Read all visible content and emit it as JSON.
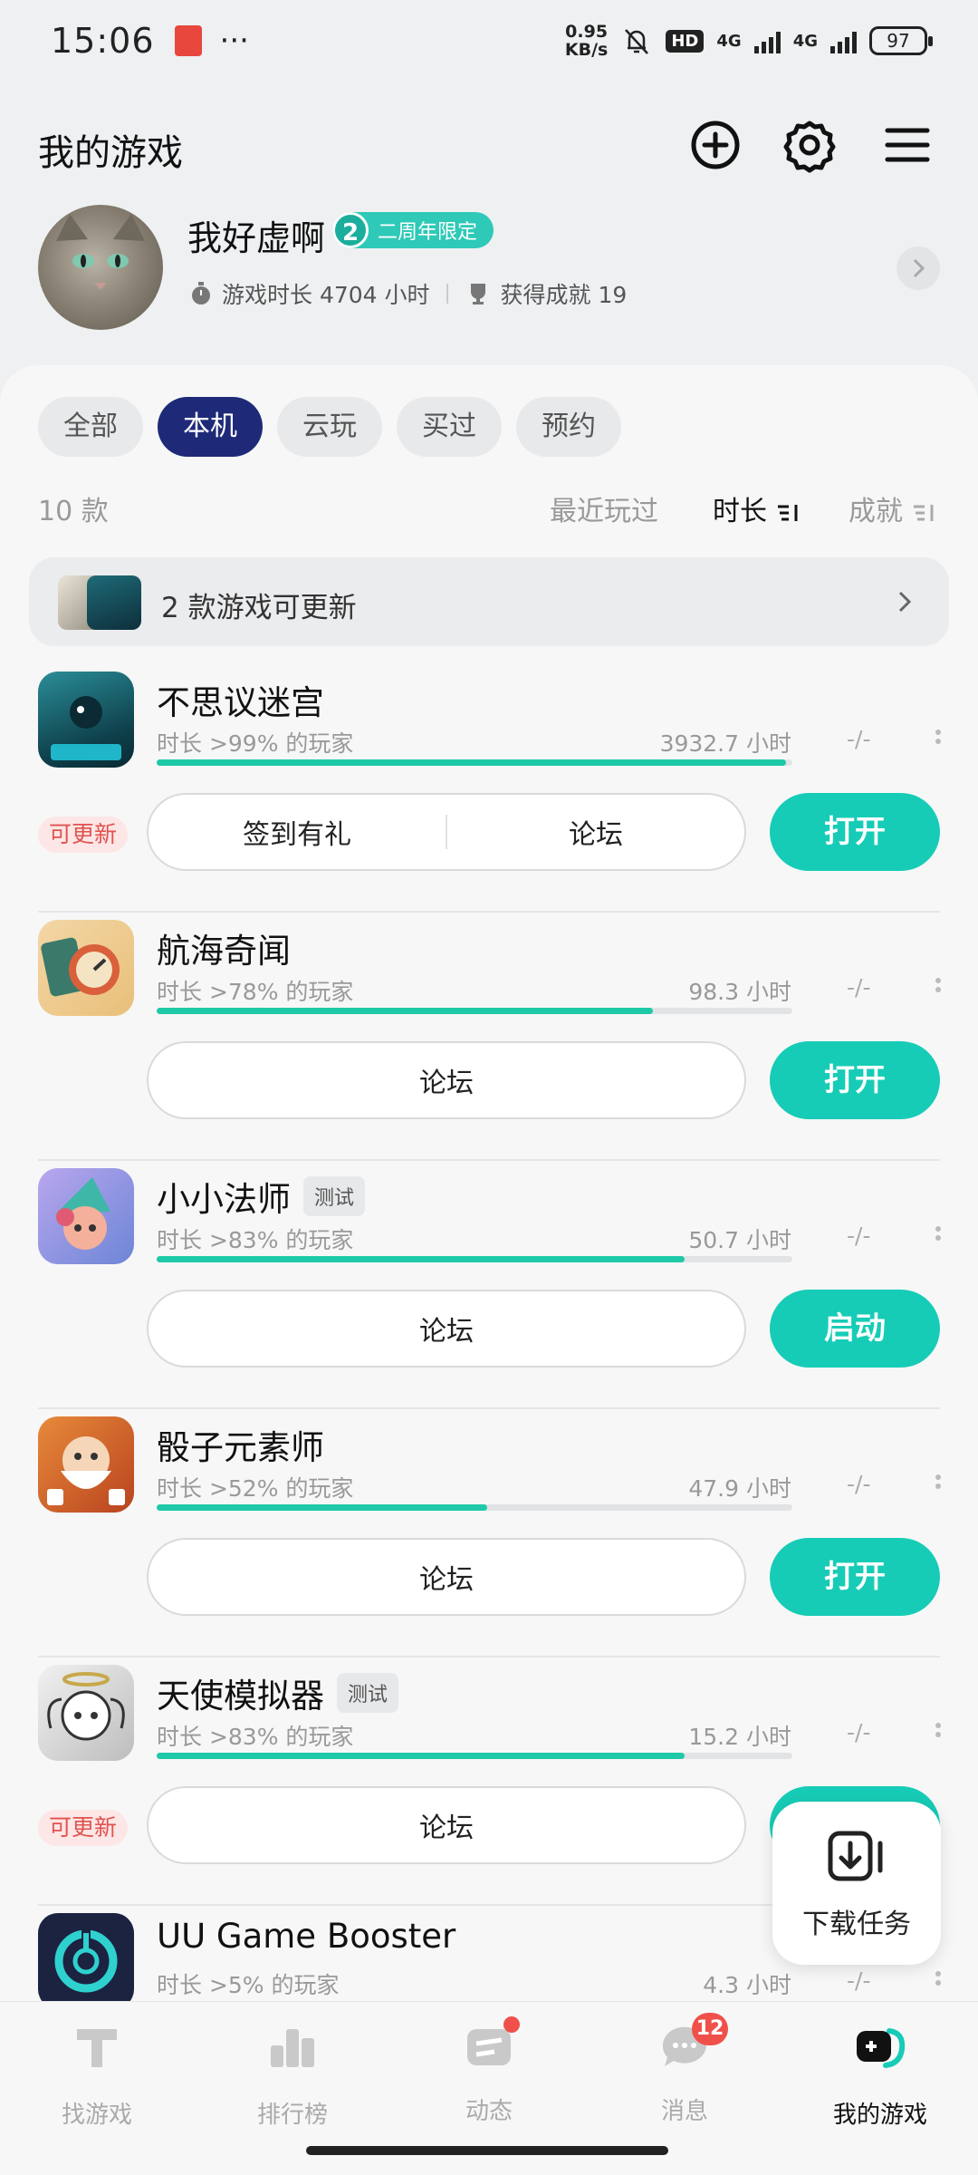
{
  "status_bar": {
    "time": "15:06",
    "speed_value": "0.95",
    "speed_unit": "KB/s",
    "battery": "97",
    "hd": "HD",
    "net1": "4G",
    "net2": "4G"
  },
  "header": {
    "title": "我的游戏"
  },
  "profile": {
    "username": "我好虚啊",
    "badge_num": "2",
    "badge_text": "二周年限定",
    "playtime": "游戏时长 4704 小时",
    "achievements": "获得成就 19"
  },
  "tabs": [
    "全部",
    "本机",
    "云玩",
    "买过",
    "预约"
  ],
  "sort": {
    "count": "10 款",
    "recent": "最近玩过",
    "duration": "时长",
    "achievement": "成就"
  },
  "update_banner": {
    "text": "2 款游戏可更新"
  },
  "games": [
    {
      "name": "不思议迷宫",
      "tag": "",
      "pct_text": "时长 >99% 的玩家",
      "hours": "3932.7 小时",
      "dash": "-/-",
      "progress": 0.99,
      "update": "可更新",
      "actions": [
        "签到有礼",
        "论坛"
      ],
      "button": "打开"
    },
    {
      "name": "航海奇闻",
      "tag": "",
      "pct_text": "时长 >78% 的玩家",
      "hours": "98.3 小时",
      "dash": "-/-",
      "progress": 0.78,
      "update": "",
      "actions": [
        "论坛"
      ],
      "button": "打开"
    },
    {
      "name": "小小法师",
      "tag": "测试",
      "pct_text": "时长 >83% 的玩家",
      "hours": "50.7 小时",
      "dash": "-/-",
      "progress": 0.83,
      "update": "",
      "actions": [
        "论坛"
      ],
      "button": "启动"
    },
    {
      "name": "骰子元素师",
      "tag": "",
      "pct_text": "时长 >52% 的玩家",
      "hours": "47.9 小时",
      "dash": "-/-",
      "progress": 0.52,
      "update": "",
      "actions": [
        "论坛"
      ],
      "button": "打开"
    },
    {
      "name": "天使模拟器",
      "tag": "测试",
      "pct_text": "时长 >83% 的玩家",
      "hours": "15.2 小时",
      "dash": "-/-",
      "progress": 0.83,
      "update": "可更新",
      "actions": [
        "论坛"
      ],
      "button": ""
    },
    {
      "name": "UU Game Booster",
      "tag": "",
      "pct_text": "时长 >5% 的玩家",
      "hours": "4.3 小时",
      "dash": "-/-",
      "progress": 0.05,
      "update": "",
      "actions": [],
      "button": ""
    }
  ],
  "download_task": {
    "label": "下载任务"
  },
  "bottom_nav": [
    {
      "label": "找游戏",
      "badge": ""
    },
    {
      "label": "排行榜",
      "badge": ""
    },
    {
      "label": "动态",
      "badge": "dot"
    },
    {
      "label": "消息",
      "badge": "12"
    },
    {
      "label": "我的游戏",
      "badge": ""
    }
  ],
  "colors": {
    "accent": "#17ccb6",
    "tab_active": "#1e2a78",
    "update_tag_bg": "#fde6e6",
    "update_tag_fg": "#e0534f"
  }
}
